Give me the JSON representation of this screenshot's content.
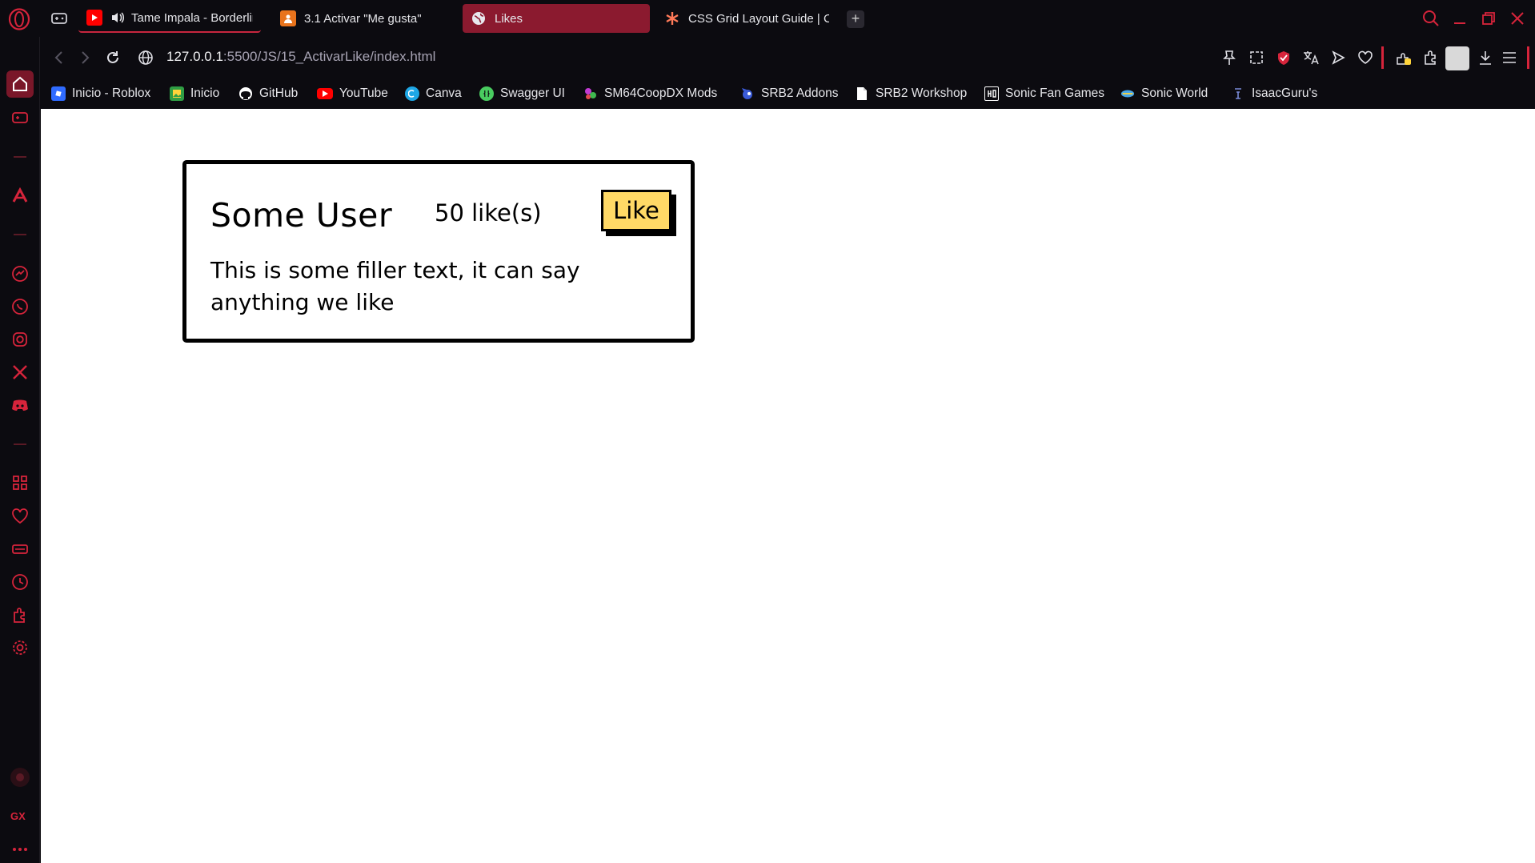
{
  "browser": {
    "tabs": [
      {
        "title": "Tame Impala - Borderline",
        "favicon": "youtube-icon",
        "audio": true
      },
      {
        "title": "3.1 Activar \"Me gusta\"",
        "favicon": "course-icon"
      },
      {
        "title": "Likes",
        "favicon": "globe-icon",
        "active": true
      },
      {
        "title": "CSS Grid Layout Guide | CSS-Tricks",
        "favicon": "asterisk-icon"
      }
    ],
    "new_tab_label": "+",
    "url": {
      "host": "127.0.0.1",
      "path": ":5500/JS/15_ActivarLike/index.html"
    },
    "bookmarks": [
      {
        "label": "Inicio - Roblox",
        "icon": "roblox-icon",
        "color": "#2f6bff"
      },
      {
        "label": "Inicio",
        "icon": "image-icon",
        "color": "#2f9e44"
      },
      {
        "label": "GitHub",
        "icon": "github-icon",
        "color": "#ffffff"
      },
      {
        "label": "YouTube",
        "icon": "youtube-icon",
        "color": "#ff0000"
      },
      {
        "label": "Canva",
        "icon": "canva-icon",
        "color": "#1ea7e6"
      },
      {
        "label": "Swagger UI",
        "icon": "swagger-icon",
        "color": "#49cc60"
      },
      {
        "label": "SM64CoopDX Mods",
        "icon": "sm64-icon",
        "color": "#c23bd3"
      },
      {
        "label": "SRB2 Addons",
        "icon": "srb2-icon",
        "color": "#3a5bd9"
      },
      {
        "label": "SRB2 Workshop",
        "icon": "page-icon",
        "color": "#ffffff"
      },
      {
        "label": "Sonic Fan Games",
        "icon": "sfg-icon",
        "color": "#ffffff"
      },
      {
        "label": "Sonic World",
        "icon": "sonic-world-icon",
        "color": "#48a6e8"
      },
      {
        "label": "IsaacGuru's",
        "icon": "isaac-icon",
        "color": "#7a8bd8"
      }
    ],
    "sidebar_label": "GX",
    "accent": "#d6243b"
  },
  "page": {
    "card": {
      "user": "Some User",
      "likes": "50 like(s)",
      "like_button": "Like",
      "text": "This is some filler text, it can say anything we like"
    },
    "button_color": "#ffd966"
  }
}
